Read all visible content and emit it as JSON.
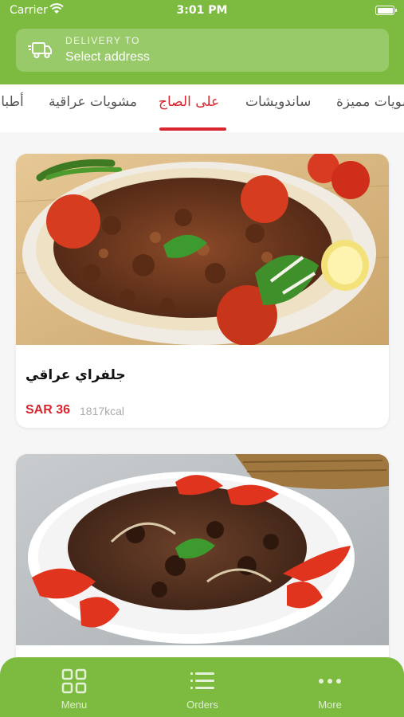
{
  "status_bar": {
    "carrier": "Carrier",
    "time": "3:01 PM"
  },
  "header": {
    "delivery_label": "DELIVERY TO",
    "address": "Select address",
    "icon": "truck-icon"
  },
  "tabs": [
    {
      "label": "أطباق",
      "active": false
    },
    {
      "label": "مشويات عراقية",
      "active": false
    },
    {
      "label": "على الصاج",
      "active": true
    },
    {
      "label": "ساندويشات",
      "active": false
    },
    {
      "label": "مشويات مميزة",
      "active": false
    }
  ],
  "items": [
    {
      "name": "جلفراي عراقي",
      "price": "SAR 36",
      "kcal": "1817kcal"
    },
    {
      "name": "",
      "price": "",
      "kcal": ""
    }
  ],
  "bottom_nav": [
    {
      "label": "Menu",
      "icon": "grid-icon"
    },
    {
      "label": "Orders",
      "icon": "list-icon"
    },
    {
      "label": "More",
      "icon": "more-icon"
    }
  ],
  "colors": {
    "brand_green": "#7cbb3f",
    "accent_red": "#d9252d"
  }
}
